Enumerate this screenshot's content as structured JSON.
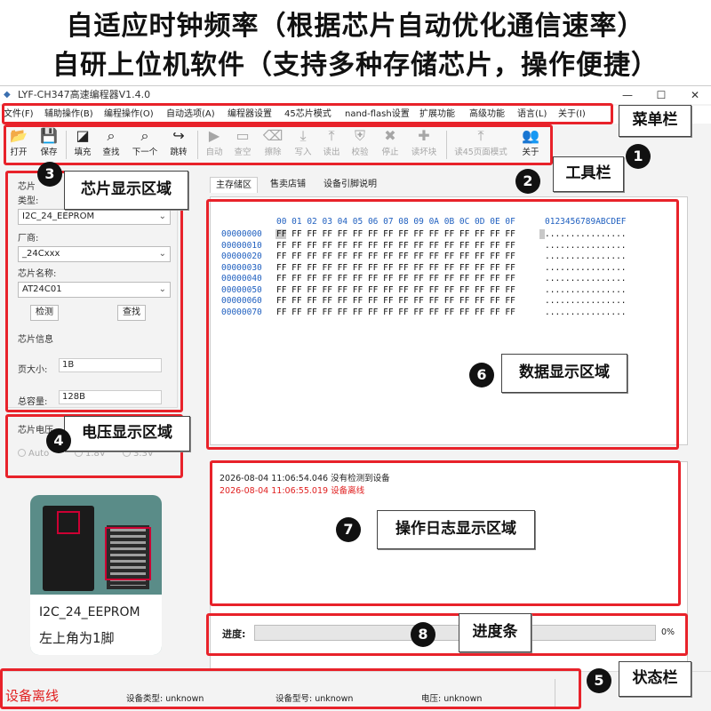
{
  "headline": {
    "line1": "自适应时钟频率（根据芯片自动优化通信速率）",
    "line2": "自研上位机软件（支持多种存储芯片，操作便捷）"
  },
  "window": {
    "title": "LYF-CH347高速编程器V1.4.0",
    "minimize": "—",
    "maximize": "☐",
    "close": "✕"
  },
  "menu": [
    "文件(F)",
    "辅助操作(B)",
    "编程操作(O)",
    "自动选项(A)",
    "编程器设置",
    "45芯片模式",
    "nand-flash设置",
    "扩展功能",
    "高级功能",
    "语言(L)",
    "关于(I)"
  ],
  "toolbar": [
    {
      "label": "打开",
      "icon": "📂",
      "enabled": true
    },
    {
      "label": "保存",
      "icon": "💾",
      "enabled": true
    },
    {
      "label": "填充",
      "icon": "◪",
      "enabled": true
    },
    {
      "label": "查找",
      "icon": "⌕",
      "enabled": true
    },
    {
      "label": "下一个",
      "icon": "⌕",
      "enabled": true
    },
    {
      "label": "跳转",
      "icon": "↪",
      "enabled": true
    },
    {
      "label": "自动",
      "icon": "▶",
      "enabled": false
    },
    {
      "label": "查空",
      "icon": "▭",
      "enabled": false
    },
    {
      "label": "擦除",
      "icon": "⌫",
      "enabled": false
    },
    {
      "label": "写入",
      "icon": "⤓",
      "enabled": false
    },
    {
      "label": "读出",
      "icon": "⤒",
      "enabled": false
    },
    {
      "label": "校验",
      "icon": "⛨",
      "enabled": false
    },
    {
      "label": "停止",
      "icon": "✖",
      "enabled": false
    },
    {
      "label": "读坏块",
      "icon": "✚",
      "enabled": false
    },
    {
      "label": "读45页面模式",
      "icon": "⤒",
      "enabled": false
    },
    {
      "label": "关于",
      "icon": "👥",
      "enabled": true
    }
  ],
  "chip": {
    "group_label": "芯片",
    "type_label": "类型:",
    "type_value": "I2C_24_EEPROM",
    "vendor_label": "厂商:",
    "vendor_value": "_24Cxxx",
    "name_label": "芯片名称:",
    "name_value": "AT24C01",
    "detect_button": "检测",
    "search_button": "查找",
    "info_label": "芯片信息",
    "page_size_label": "页大小:",
    "page_size_value": "1B",
    "capacity_label": "总容量:",
    "capacity_value": "128B"
  },
  "voltage": {
    "label": "芯片电压",
    "options": [
      "Auto",
      "1.8V",
      "3.3V"
    ]
  },
  "chip_image": {
    "line1": "I2C_24_EEPROM",
    "line2": "左上角为1脚"
  },
  "tabs": [
    "主存储区",
    "售卖店铺",
    "设备引脚说明"
  ],
  "hex": {
    "header": "00 01 02 03 04 05 06 07 08 09 0A 0B 0C 0D 0E 0F",
    "ascii_header": "0123456789ABCDEF",
    "rows": [
      {
        "addr": "00000000",
        "bytes": "FF FF FF FF FF FF FF FF FF FF FF FF FF FF FF FF",
        "ascii": "................"
      },
      {
        "addr": "00000010",
        "bytes": "FF FF FF FF FF FF FF FF FF FF FF FF FF FF FF FF",
        "ascii": "................"
      },
      {
        "addr": "00000020",
        "bytes": "FF FF FF FF FF FF FF FF FF FF FF FF FF FF FF FF",
        "ascii": "................"
      },
      {
        "addr": "00000030",
        "bytes": "FF FF FF FF FF FF FF FF FF FF FF FF FF FF FF FF",
        "ascii": "................"
      },
      {
        "addr": "00000040",
        "bytes": "FF FF FF FF FF FF FF FF FF FF FF FF FF FF FF FF",
        "ascii": "................"
      },
      {
        "addr": "00000050",
        "bytes": "FF FF FF FF FF FF FF FF FF FF FF FF FF FF FF FF",
        "ascii": "................"
      },
      {
        "addr": "00000060",
        "bytes": "FF FF FF FF FF FF FF FF FF FF FF FF FF FF FF FF",
        "ascii": "................"
      },
      {
        "addr": "00000070",
        "bytes": "FF FF FF FF FF FF FF FF FF FF FF FF FF FF FF FF",
        "ascii": "................"
      }
    ]
  },
  "log": [
    {
      "text": "2026-08-04 11:06:54.046 没有检测到设备",
      "color": "#111111"
    },
    {
      "text": "2026-08-04 11:06:55.019 设备离线",
      "color": "#e02020"
    }
  ],
  "progress": {
    "label": "进度:",
    "value": 0,
    "percent_text": "0%"
  },
  "status": {
    "connection": "设备离线",
    "device_type": "设备类型:  unknown",
    "device_model": "设备型号:  unknown",
    "voltage": "电压:  unknown"
  },
  "callouts": {
    "menubar": {
      "num": "1",
      "label": "菜单栏"
    },
    "toolbar": {
      "num": "2",
      "label": "工具栏"
    },
    "chip_area": {
      "num": "3",
      "label": "芯片显示区域"
    },
    "voltage_area": {
      "num": "4",
      "label": "电压显示区域"
    },
    "statusbar": {
      "num": "5",
      "label": "状态栏"
    },
    "data_area": {
      "num": "6",
      "label": "数据显示区域"
    },
    "log_area": {
      "num": "7",
      "label": "操作日志显示区域"
    },
    "progress": {
      "num": "8",
      "label": "进度条"
    }
  },
  "colors": {
    "annotation_red": "#e8222a",
    "hex_address_blue": "#2060c0",
    "offline_red": "#e02020"
  }
}
